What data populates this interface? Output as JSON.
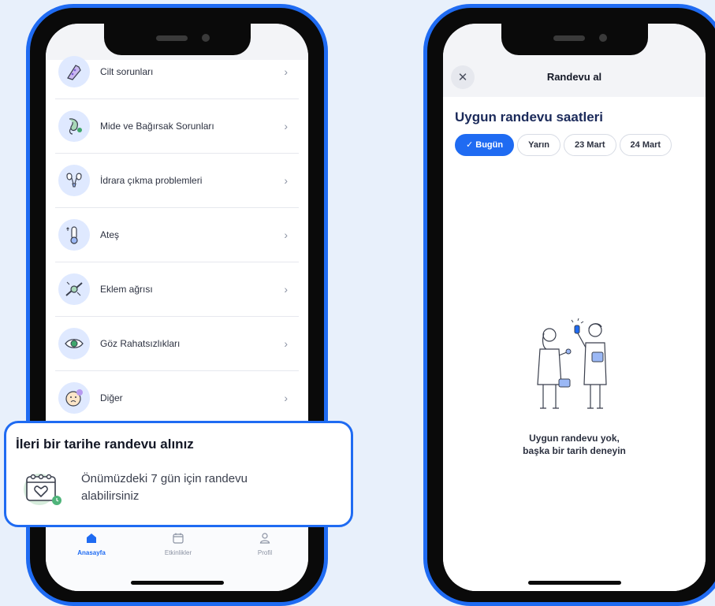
{
  "left_phone": {
    "categories": [
      {
        "label": "Cilt sorunları",
        "icon": "skin-hand-icon"
      },
      {
        "label": "Mide ve Bağırsak Sorunları",
        "icon": "stomach-icon"
      },
      {
        "label": "İdrara çıkma problemleri",
        "icon": "kidney-icon"
      },
      {
        "label": "Ateş",
        "icon": "thermometer-icon"
      },
      {
        "label": "Eklem ağrısı",
        "icon": "joint-icon"
      },
      {
        "label": "Göz Rahatsızlıkları",
        "icon": "eye-icon"
      },
      {
        "label": "Diğer",
        "icon": "sick-face-icon"
      }
    ],
    "tabs": [
      {
        "label": "Anasayfa",
        "icon": "home-icon",
        "active": true
      },
      {
        "label": "Etkinlikler",
        "icon": "calendar-icon",
        "active": false
      },
      {
        "label": "Profil",
        "icon": "profile-icon",
        "active": false
      }
    ]
  },
  "card": {
    "title": "İleri bir tarihe randevu alınız",
    "text": "Önümüzdeki 7 gün için randevu alabilirsiniz",
    "icon": "calendar-heart-icon"
  },
  "right_phone": {
    "header_title": "Randevu al",
    "section_title": "Uygun randevu saatleri",
    "chips": [
      {
        "label": "✓ Bugün",
        "selected": true
      },
      {
        "label": "Yarın",
        "selected": false
      },
      {
        "label": "23 Mart",
        "selected": false
      },
      {
        "label": "24 Mart",
        "selected": false
      }
    ],
    "empty_line1": "Uygun randevu yok,",
    "empty_line2": "başka bir tarih deneyin",
    "illustration": "doctors-illustration"
  },
  "colors": {
    "accent": "#1f6bf2",
    "background": "#e8f0fb",
    "icon_bg": "#dfe9ff"
  }
}
